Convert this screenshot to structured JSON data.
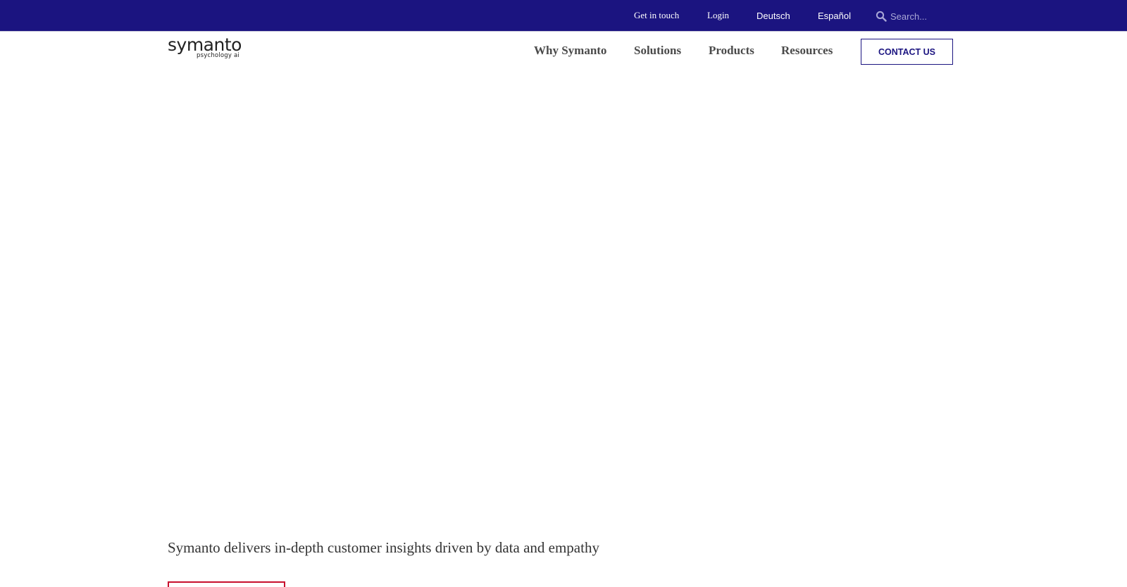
{
  "topbar": {
    "links": [
      {
        "label": "Get in touch"
      },
      {
        "label": "Login"
      },
      {
        "label": "Deutsch"
      },
      {
        "label": "Español"
      }
    ],
    "search": {
      "placeholder": "Search...",
      "value": ""
    }
  },
  "logo": {
    "word": "symanto",
    "tagline": "psychology ai"
  },
  "nav": {
    "items": [
      {
        "label": "Why Symanto"
      },
      {
        "label": "Solutions"
      },
      {
        "label": "Products"
      },
      {
        "label": "Resources"
      }
    ],
    "cta_label": "CONTACT US"
  },
  "hero": {
    "headline": "Symanto delivers in-depth customer insights driven by data and empathy"
  },
  "colors": {
    "topbar_bg": "#1b1480",
    "accent": "#1b1480",
    "cta_border": "#c8102e"
  }
}
